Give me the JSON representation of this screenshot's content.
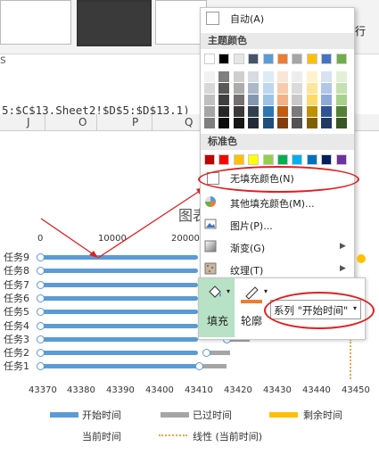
{
  "formula": {
    "text": "5:$C$13,Sheet2!$D$5:$D$13,1)"
  },
  "columns": [
    "J",
    "O",
    "P",
    "Q"
  ],
  "ribbon": {
    "right_partial": "行"
  },
  "color_menu": {
    "auto_label": "自动(A)",
    "theme_header": "主题颜色",
    "standard_header": "标准色",
    "no_fill": "无填充颜色(N)",
    "more_colors": "其他填充颜色(M)...",
    "picture": "图片(P)...",
    "gradient": "渐变(G)",
    "texture": "纹理(T)",
    "theme_colors": [
      "#ffffff",
      "#000000",
      "#e7e6e6",
      "#44546a",
      "#5b9bd5",
      "#ed7d31",
      "#a5a5a5",
      "#ffc000",
      "#4472c4",
      "#70ad47"
    ],
    "theme_shades": [
      [
        "#f2f2f2",
        "#7f7f7f",
        "#d0cece",
        "#d6dce4",
        "#deebf6",
        "#fbe5d5",
        "#ededed",
        "#fff2cc",
        "#d9e2f3",
        "#e2efd9"
      ],
      [
        "#d8d8d8",
        "#595959",
        "#aeabab",
        "#adb9ca",
        "#bdd7ee",
        "#f7cbac",
        "#dbdbdb",
        "#fee599",
        "#b4c6e7",
        "#c5e0b3"
      ],
      [
        "#bfbfbf",
        "#3f3f3f",
        "#757070",
        "#8496b0",
        "#9cc3e5",
        "#f4b183",
        "#c9c9c9",
        "#ffd965",
        "#8eaadb",
        "#a8d08d"
      ],
      [
        "#a5a5a5",
        "#262626",
        "#3a3838",
        "#323f4f",
        "#2e75b5",
        "#c55a11",
        "#7b7b7b",
        "#bf9000",
        "#2f5496",
        "#538135"
      ],
      [
        "#7f7f7f",
        "#0c0c0c",
        "#171616",
        "#222a35",
        "#1e4e79",
        "#833c0b",
        "#525252",
        "#7f6000",
        "#1f3864",
        "#375623"
      ]
    ],
    "standard_colors": [
      "#c00000",
      "#ff0000",
      "#ffc000",
      "#ffff00",
      "#92d050",
      "#00b050",
      "#00b0f0",
      "#0070c0",
      "#002060",
      "#7030a0"
    ]
  },
  "chart": {
    "title_partial": "图表"
  },
  "chart_data": {
    "type": "bar",
    "title": "图表",
    "categories": [
      "任务9",
      "任务8",
      "任务7",
      "任务6",
      "任务5",
      "任务4",
      "任务3",
      "任务2",
      "任务1"
    ],
    "x_top_ticks": [
      "0",
      "10000",
      "20000"
    ],
    "x_bottom_ticks": [
      "43370",
      "43380",
      "43390",
      "43400",
      "43410",
      "43420",
      "43430",
      "43440",
      "43450"
    ],
    "series": [
      {
        "name": "开始时间",
        "values": [
          43420,
          43420,
          43420,
          43420,
          43420,
          43420,
          43417,
          43412,
          43410
        ]
      },
      {
        "name": "已过时间",
        "values": [
          0,
          0,
          0,
          0,
          0,
          0,
          6,
          6,
          7
        ]
      },
      {
        "name": "剩余时间",
        "values": []
      },
      {
        "name": "当前时间",
        "values": []
      },
      {
        "name": "线性 (当前时间)",
        "values": []
      }
    ],
    "ylim": [
      43370,
      43450
    ],
    "legend": "bottom"
  },
  "mini_toolbar": {
    "fill_label": "填充",
    "outline_label": "轮廓",
    "series_select": "系列 \"开始时间\""
  },
  "legend": {
    "start": "开始时间",
    "elapsed": "已过时间",
    "remaining": "剩余时间",
    "current": "当前时间",
    "trend": "线性 (当前时间)"
  }
}
